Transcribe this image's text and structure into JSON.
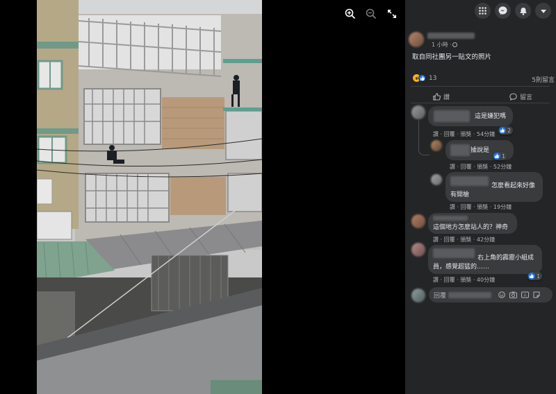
{
  "viewer": {
    "controls": [
      {
        "name": "zoom-in-icon"
      },
      {
        "name": "zoom-out-icon"
      },
      {
        "name": "fullscreen-icon"
      }
    ]
  },
  "topbar": {
    "icons": [
      "menu-grid-icon",
      "messenger-icon",
      "notifications-icon",
      "account-arrow-icon"
    ]
  },
  "post": {
    "time": "1 小時 · ",
    "caption": "取自同社團另一貼文的照片",
    "reaction_count": "13",
    "comment_count": "5則留言",
    "like_label": "讚",
    "comment_label": "留言"
  },
  "comments": [
    {
      "text": "這是嫌犯嗎",
      "meta": "讚 · 回覆 · 頒獎 · 54分鐘",
      "reactions": "2"
    },
    {
      "text": "據說是",
      "meta": "讚 · 回覆 · 頒獎 · 52分鐘",
      "reactions": "1"
    },
    {
      "text_line1": "怎麼看起來好像",
      "text_line2": "有開槍",
      "meta": "讚 · 回覆 · 頒獎 · 19分鐘"
    },
    {
      "text": "這個地方怎麼站人的？神奇",
      "meta": "讚 · 回覆 · 頒獎 · 42分鐘"
    },
    {
      "text_line1": "右上角的霹靂小組成",
      "text_line2": "員，感覺超猛的……",
      "meta": "讚 · 回覆 · 頒獎 · 40分鐘",
      "reactions": "1"
    }
  ],
  "composer": {
    "placeholder": "回覆",
    "icons": [
      "emoji-icon",
      "camera-icon",
      "gif-icon",
      "sticker-icon"
    ]
  },
  "colors": {
    "panel_bg": "#242526",
    "bubble_bg": "#3a3b3c",
    "like_blue": "#1877f2",
    "text_primary": "#e4e6eb",
    "text_secondary": "#b0b3b8"
  }
}
